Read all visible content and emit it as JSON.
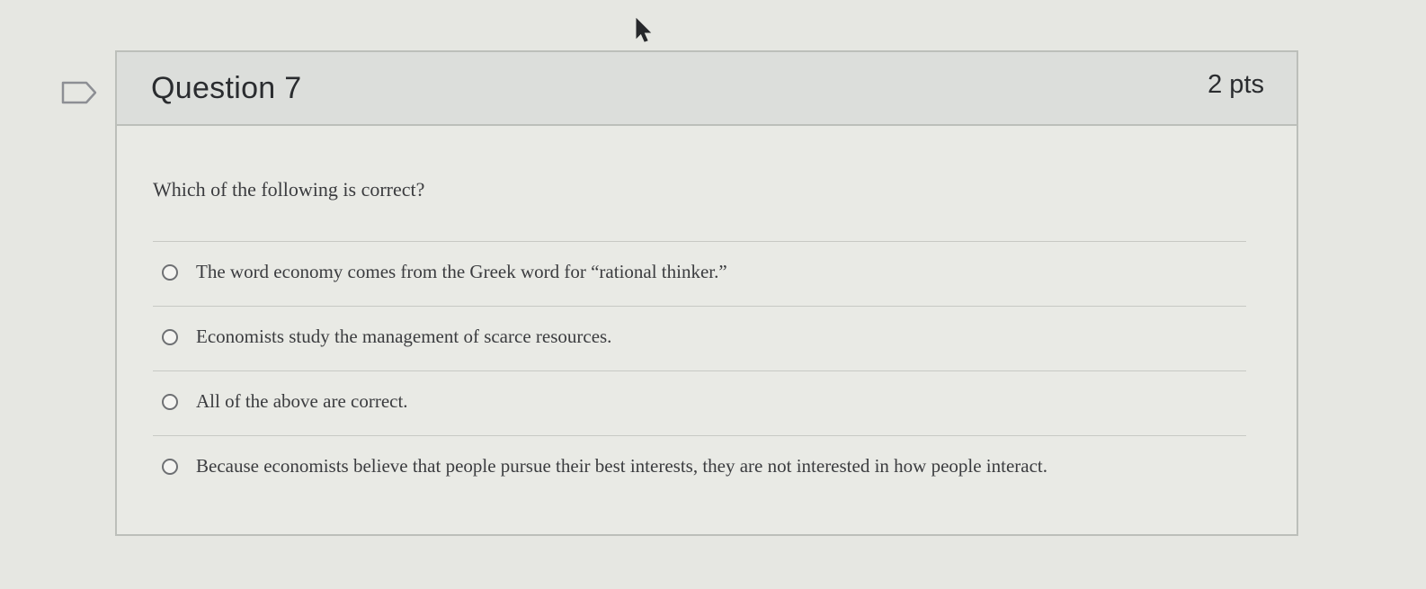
{
  "question": {
    "title": "Question 7",
    "points": "2 pts",
    "prompt": "Which of the following is correct?",
    "answers": [
      {
        "label": "The word economy comes from the Greek word for “rational thinker.”"
      },
      {
        "label": "Economists study the management of scarce resources."
      },
      {
        "label": "All of the above are correct."
      },
      {
        "label": "Because economists believe that people pursue their best interests, they are not interested in how people interact."
      }
    ]
  },
  "icons": {
    "flag": "bookmark-flag-icon",
    "cursor": "mouse-pointer-icon"
  },
  "colors": {
    "page_background": "#e6e7e2",
    "header_background": "#dcdedb",
    "border": "#bcbfba",
    "text": "#2a2c2f"
  }
}
